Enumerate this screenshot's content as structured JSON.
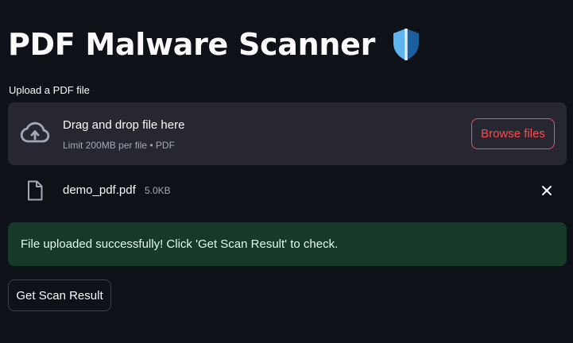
{
  "header": {
    "title": "PDF Malware Scanner",
    "emoji_icon": "shield-icon"
  },
  "uploader": {
    "label": "Upload a PDF file",
    "drop_text": "Drag and drop file here",
    "limit_text": "Limit 200MB per file • PDF",
    "browse_label": "Browse files",
    "upload_icon": "cloud-upload-icon"
  },
  "uploaded_file": {
    "name": "demo_pdf.pdf",
    "size": "5.0KB",
    "file_icon": "file-icon",
    "remove_icon": "close-icon"
  },
  "alert": {
    "message": "File uploaded successfully! Click 'Get Scan Result' to check."
  },
  "actions": {
    "scan_label": "Get Scan Result"
  },
  "colors": {
    "background": "#0e1117",
    "panel": "#262730",
    "accent": "#ff4b4b",
    "success_bg": "#173928",
    "success_text": "#dffde9"
  }
}
